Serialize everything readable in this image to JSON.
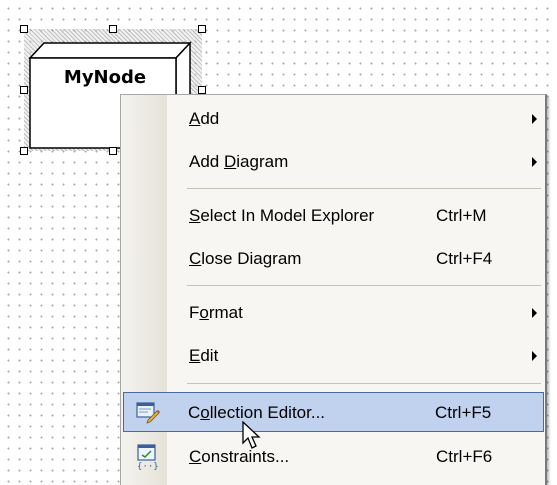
{
  "diagram": {
    "node": {
      "label": "MyNode"
    }
  },
  "context_menu": {
    "items": [
      {
        "pre": "",
        "mn": "A",
        "post": "dd",
        "shortcut": "",
        "submenu": true
      },
      {
        "pre": "Add ",
        "mn": "D",
        "post": "iagram",
        "shortcut": "",
        "submenu": true
      },
      {
        "pre": "",
        "mn": "S",
        "post": "elect In Model Explorer",
        "shortcut": "Ctrl+M",
        "submenu": false
      },
      {
        "pre": "",
        "mn": "C",
        "post": "lose Diagram",
        "shortcut": "Ctrl+F4",
        "submenu": false
      },
      {
        "pre": "F",
        "mn": "o",
        "post": "rmat",
        "shortcut": "",
        "submenu": true
      },
      {
        "pre": "",
        "mn": "E",
        "post": "dit",
        "shortcut": "",
        "submenu": true
      },
      {
        "pre": "C",
        "mn": "o",
        "post": "llection Editor...",
        "shortcut": "Ctrl+F5",
        "submenu": false,
        "highlighted": true,
        "icon": "collection-editor-icon"
      },
      {
        "pre": "",
        "mn": "C",
        "post": "onstraints...",
        "shortcut": "Ctrl+F6",
        "submenu": false,
        "icon": "constraints-icon"
      }
    ]
  },
  "colors": {
    "menu_bg": "#f7f6f2",
    "highlight_bg": "#c1d2ee",
    "highlight_border": "#4a6b9c",
    "grid_dot": "#a9a9a9"
  }
}
